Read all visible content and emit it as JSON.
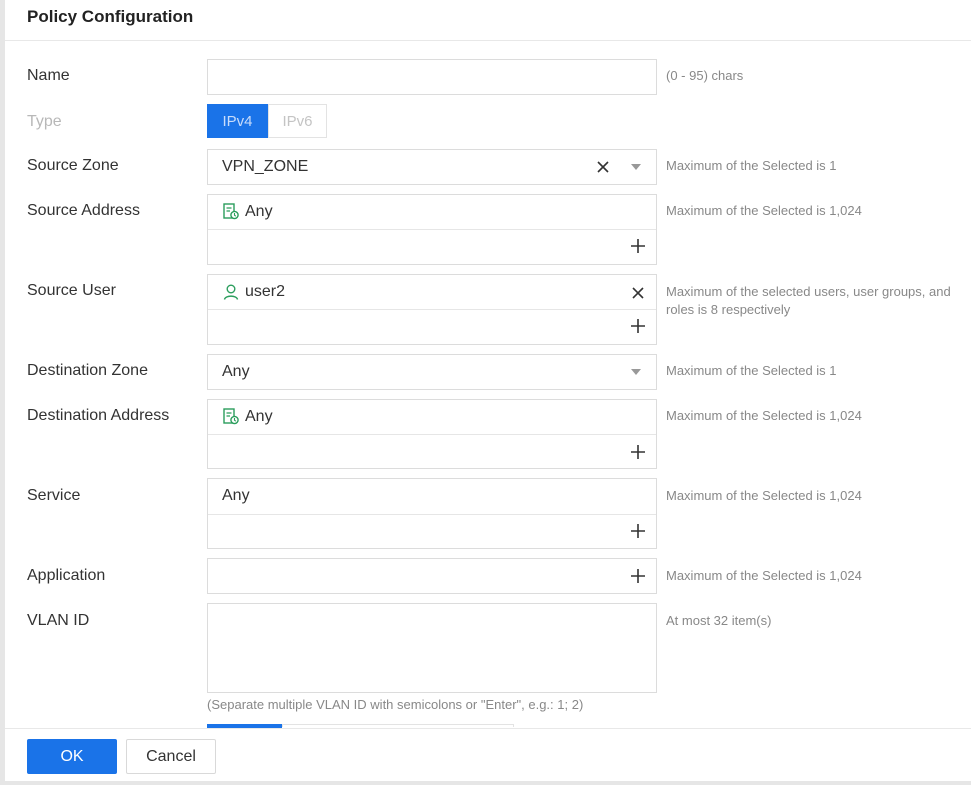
{
  "header": {
    "title": "Policy Configuration"
  },
  "name_field": {
    "label": "Name",
    "value": "",
    "hint": "(0 - 95) chars"
  },
  "type_field": {
    "label": "Type",
    "options": [
      "IPv4",
      "IPv6"
    ],
    "selected": "IPv4"
  },
  "source_zone": {
    "label": "Source Zone",
    "value": "VPN_ZONE",
    "hint": "Maximum of the Selected is 1",
    "clear_icon": "close-icon",
    "dropdown_icon": "caret-down-icon"
  },
  "source_address": {
    "label": "Source Address",
    "items": [
      "Any"
    ],
    "hint": "Maximum of the Selected is 1,024",
    "item_icon": "address-book-icon",
    "add_icon": "plus-icon"
  },
  "source_user": {
    "label": "Source User",
    "items": [
      "user2"
    ],
    "hint": "Maximum of the selected users, user groups, and roles is 8 respectively",
    "item_icon": "user-icon",
    "remove_icon": "close-icon",
    "add_icon": "plus-icon"
  },
  "destination_zone": {
    "label": "Destination Zone",
    "value": "Any",
    "hint": "Maximum of the Selected is 1",
    "dropdown_icon": "caret-down-icon"
  },
  "destination_address": {
    "label": "Destination Address",
    "items": [
      "Any"
    ],
    "hint": "Maximum of the Selected is 1,024",
    "item_icon": "address-book-icon",
    "add_icon": "plus-icon"
  },
  "service": {
    "label": "Service",
    "items": [
      "Any"
    ],
    "hint": "Maximum of the Selected is 1,024",
    "add_icon": "plus-icon"
  },
  "application": {
    "label": "Application",
    "value": "",
    "hint": "Maximum of the Selected is 1,024",
    "add_icon": "plus-icon"
  },
  "vlan_id": {
    "label": "VLAN ID",
    "value": "",
    "hint": "At most 32 item(s)",
    "note": "(Separate multiple VLAN ID with semicolons or \"Enter\", e.g.: 1; 2)"
  },
  "colors": {
    "accent": "#1a73e8",
    "icon_green": "#2a9d5c",
    "hint_gray": "#888888"
  },
  "footer": {
    "ok_label": "OK",
    "cancel_label": "Cancel"
  }
}
